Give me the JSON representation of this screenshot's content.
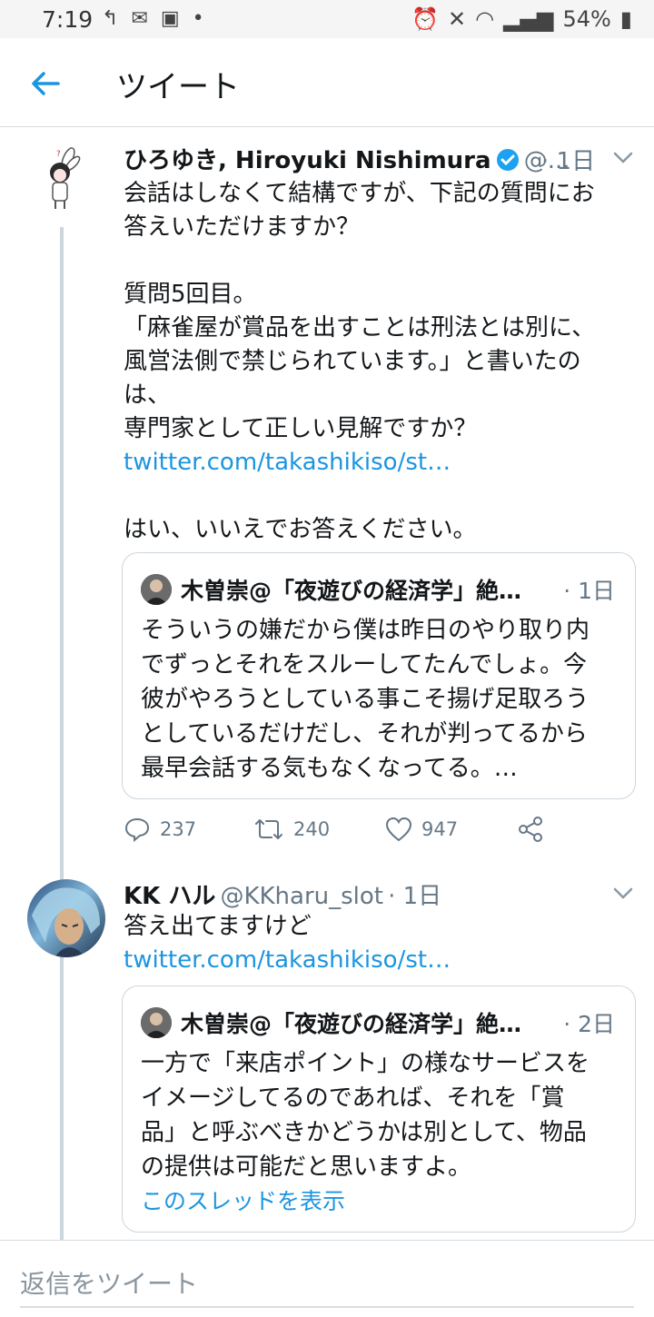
{
  "status_bar": {
    "time": "7:19",
    "battery": "54%"
  },
  "header": {
    "title": "ツイート"
  },
  "tweet1": {
    "name": "ひろゆき, Hiroyuki Nishimura",
    "handle": "@...",
    "time": "· 1日",
    "lines": [
      "会話はしなくて結構ですが、下記の質問にお",
      "答えいただけますか？",
      "",
      "質問5回目。",
      "「麻雀屋が賞品を出すことは刑法とは別に、",
      "風営法側で禁じられています。」と書いたの",
      "は、",
      "専門家として正しい見解ですか？"
    ],
    "link": "twitter.com/takashikiso/st…",
    "closing": "はい、いいえでお答えください。",
    "quote": {
      "name": "木曽崇@「夜遊びの経済学」絶…",
      "time": "· 1日",
      "lines": [
        "そういうの嫌だから僕は昨日のやり取り内",
        "でずっとそれをスルーしてたんでしょ。今",
        "彼がやろうとしている事こそ揚げ足取ろう",
        "としているだけだし、それが判ってるから",
        "最早会話する気もなくなってる。…"
      ]
    },
    "counts": {
      "replies": "237",
      "retweets": "240",
      "likes": "947"
    }
  },
  "tweet2": {
    "name": "KK ハル",
    "handle": "@KKharu_slot",
    "time": "· 1日",
    "text": "答え出てますけど",
    "link": "twitter.com/takashikiso/st…",
    "quote": {
      "name": "木曽崇@「夜遊びの経済学」絶…",
      "time": "· 2日",
      "lines": [
        "一方で「来店ポイント」の様なサービスを",
        "イメージしてるのであれば、それを「賞",
        "品」と呼ぶべきかどうかは別として、物品",
        "の提供は可能だと思いますよ。"
      ],
      "thread_link": "このスレッドを表示"
    }
  },
  "reply_bar": {
    "placeholder": "返信をツイート"
  },
  "colors": {
    "accent": "#1b95e0",
    "muted": "#657786",
    "border": "#ccd6dd"
  },
  "icons": [
    "back-arrow-icon",
    "verified-badge-icon",
    "chevron-down-icon",
    "reply-icon",
    "retweet-icon",
    "like-icon",
    "share-icon"
  ]
}
